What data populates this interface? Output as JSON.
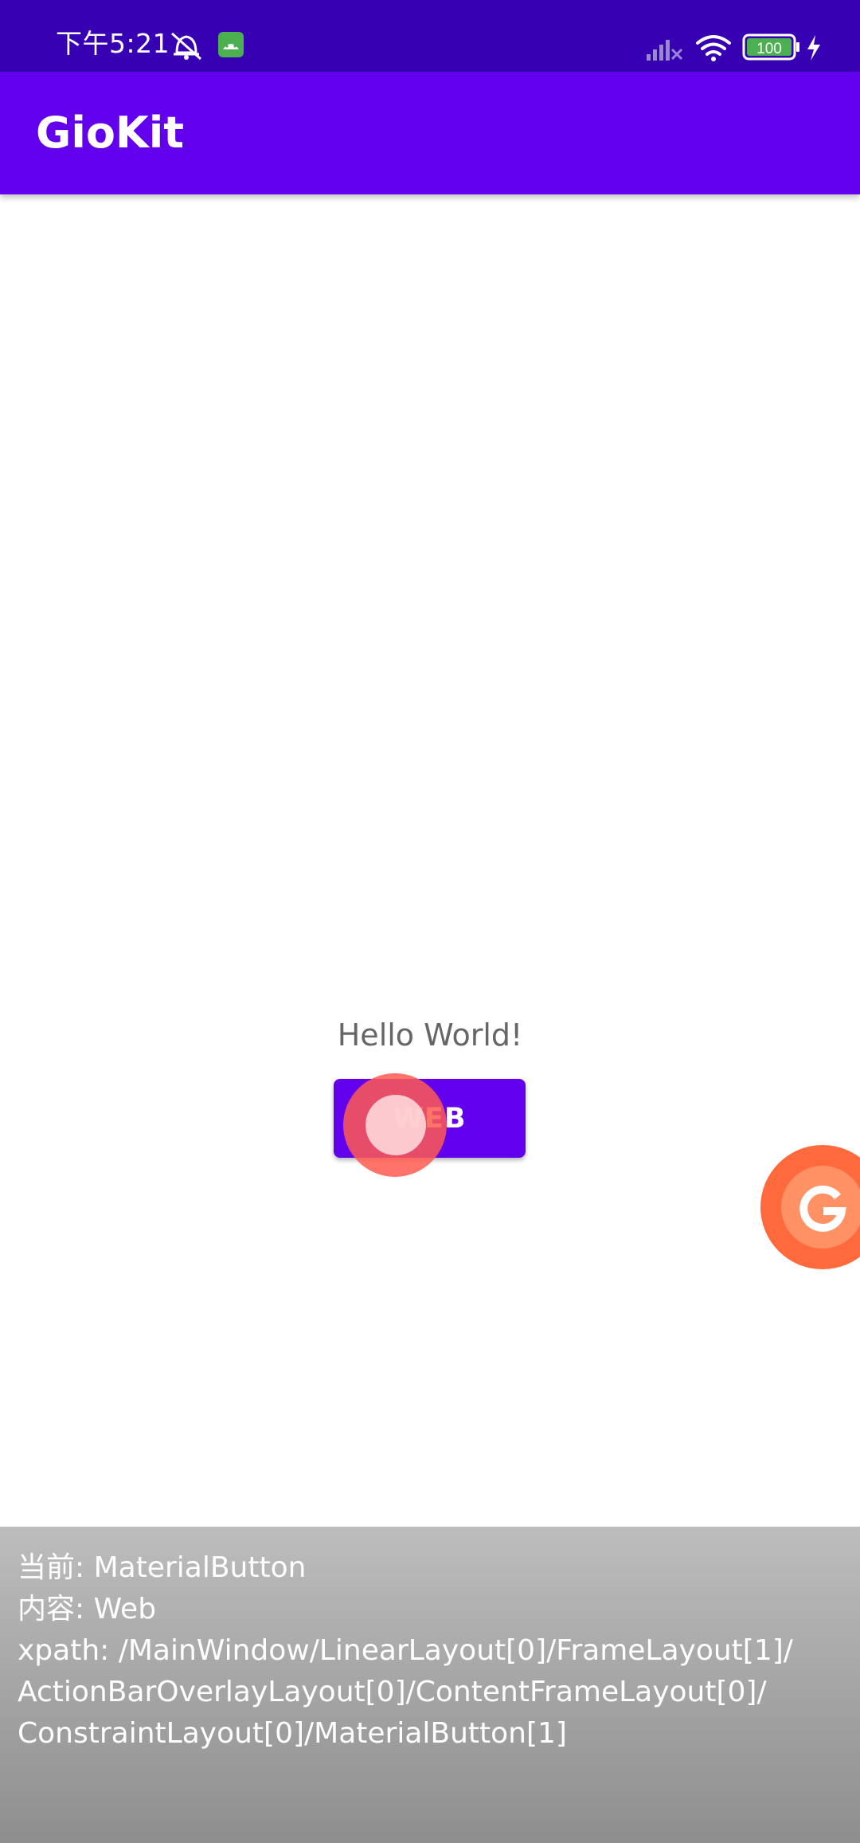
{
  "status_bar": {
    "time": "下午5:21",
    "battery": "100",
    "icons": [
      "alarm-off-icon",
      "android-app-icon",
      "signal-icon",
      "wifi-icon",
      "battery-icon",
      "charging-icon"
    ]
  },
  "app_bar": {
    "title": "GioKit"
  },
  "main": {
    "hello_text": "Hello World!",
    "web_button_label": "WEB"
  },
  "floating_button": {
    "icon": "growingio-g-icon",
    "letter": "G"
  },
  "info_panel": {
    "current_line": "当前: MaterialButton",
    "content_line": "内容: Web",
    "xpath_lines": [
      "xpath: /MainWindow/LinearLayout[0]/FrameLayout[1]/",
      "ActionBarOverlayLayout[0]/ContentFrameLayout[0]/",
      "ConstraintLayout[0]/MaterialButton[1]"
    ]
  },
  "colors": {
    "status_bar": "#3700b3",
    "app_bar": "#6200ee",
    "button": "#6200ee",
    "floating_button": "#ff6a3c",
    "touch_indicator": "#ff5a50"
  }
}
